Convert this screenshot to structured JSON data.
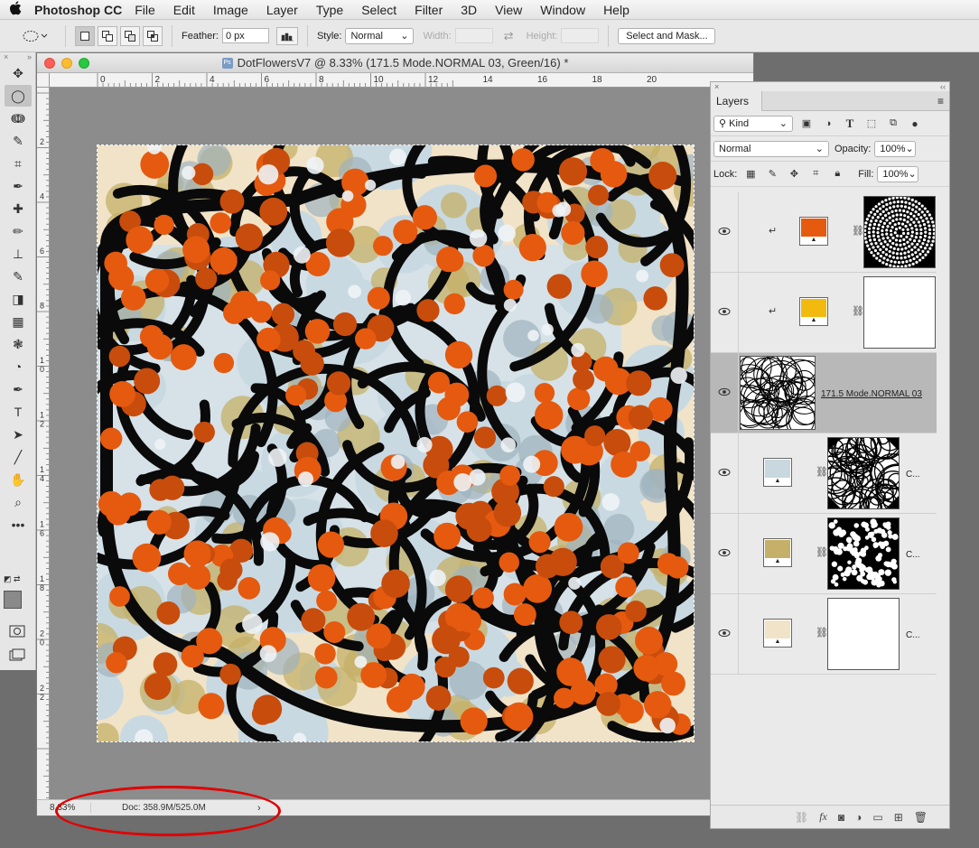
{
  "menubar": {
    "apple": "",
    "app_name": "Photoshop CC",
    "items": [
      "File",
      "Edit",
      "Image",
      "Layer",
      "Type",
      "Select",
      "Filter",
      "3D",
      "View",
      "Window",
      "Help"
    ]
  },
  "options_bar": {
    "feather_label": "Feather:",
    "feather_value": "0 px",
    "style_label": "Style:",
    "style_value": "Normal",
    "width_label": "Width:",
    "height_label": "Height:",
    "select_mask_label": "Select and Mask..."
  },
  "tools": {
    "items": [
      "move-tool",
      "elliptical-marquee-tool",
      "lasso-tool",
      "quick-selection-tool",
      "crop-tool",
      "eyedropper-tool",
      "healing-brush-tool",
      "brush-tool",
      "clone-stamp-tool",
      "history-brush-tool",
      "eraser-tool",
      "gradient-tool",
      "blur-tool",
      "dodge-tool",
      "pen-tool",
      "type-tool",
      "path-selection-tool",
      "line-tool",
      "hand-tool",
      "zoom-tool",
      "edit-toolbar"
    ],
    "glyphs": [
      "✥",
      "◯",
      "ↈ",
      "✎",
      "⌗",
      "✒",
      "✚",
      "✏",
      "⊥",
      "✎",
      "◨",
      "▦",
      "❃",
      "◔",
      "✒",
      "T",
      "➤",
      "╱",
      "✋",
      "⌕",
      "•••"
    ],
    "foreground_color": "#8a8a8a",
    "background_color": "#ffffff"
  },
  "document": {
    "title": "DotFlowersV7 @ 8.33% (171.5 Mode.NORMAL 03, Green/16) *",
    "ruler_h": [
      "0",
      "2",
      "4",
      "6",
      "8",
      "10",
      "12",
      "14",
      "16",
      "18",
      "20"
    ],
    "ruler_v": [
      "2",
      "4",
      "6",
      "8",
      "10",
      "12",
      "14",
      "16",
      "18",
      "20",
      "22"
    ],
    "zoom": "8.33%",
    "doc_size": "Doc: 358.9M/525.0M"
  },
  "layers_panel": {
    "close_label": "×",
    "collapse_label": "‹‹",
    "tab_label": "Layers",
    "kind_label": "Kind",
    "blend_mode": "Normal",
    "opacity_label": "Opacity:",
    "opacity_value": "100%",
    "lock_label": "Lock:",
    "fill_label": "Fill:",
    "fill_value": "100%",
    "layers": [
      {
        "name": "",
        "swatch": "#e55a0f",
        "clipped": true,
        "mask": "dots-ring"
      },
      {
        "name": "",
        "swatch": "#f2b90f",
        "clipped": true,
        "mask": "white"
      },
      {
        "name": "171.5 Mode.NORMAL 03",
        "swatch": "",
        "clipped": false,
        "mask": "scribble"
      },
      {
        "name": "C...",
        "swatch": "#c9d7de",
        "clipped": false,
        "mask": "web"
      },
      {
        "name": "C...",
        "swatch": "#c4b068",
        "clipped": false,
        "mask": "dots"
      },
      {
        "name": "C...",
        "swatch": "#f1e3c8",
        "clipped": false,
        "mask": "white"
      }
    ]
  }
}
